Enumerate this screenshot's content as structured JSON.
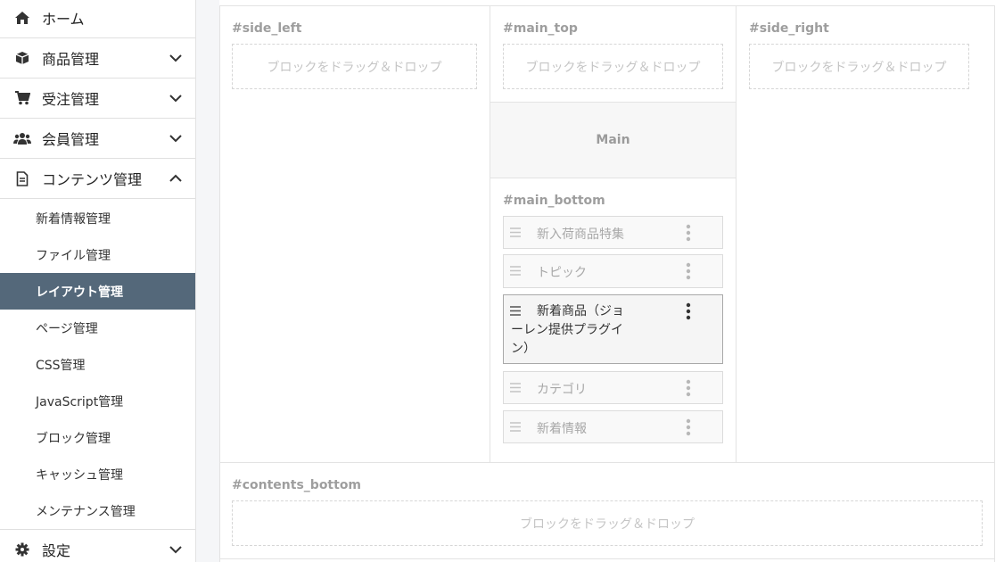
{
  "sidebar": {
    "home": "ホーム",
    "products": "商品管理",
    "orders": "受注管理",
    "members": "会員管理",
    "contents": "コンテンツ管理",
    "contents_sub": [
      "新着情報管理",
      "ファイル管理",
      "レイアウト管理",
      "ページ管理",
      "CSS管理",
      "JavaScript管理",
      "ブロック管理",
      "キャッシュ管理",
      "メンテナンス管理"
    ],
    "settings": "設定",
    "active_item": "レイアウト管理"
  },
  "layout": {
    "side_left": {
      "title": "#side_left",
      "placeholder": "ブロックをドラッグ＆ドロップ"
    },
    "main_top": {
      "title": "#main_top",
      "placeholder": "ブロックをドラッグ＆ドロップ"
    },
    "side_right": {
      "title": "#side_right",
      "placeholder": "ブロックをドラッグ＆ドロップ"
    },
    "main_label": "Main",
    "main_bottom": {
      "title": "#main_bottom",
      "blocks": [
        "新入荷商品特集",
        "トピック",
        "新着商品（ジョーレン提供プラグイン）",
        "カテゴリ",
        "新着情報"
      ]
    },
    "contents_bottom": {
      "title": "#contents_bottom",
      "placeholder": "ブロックをドラッグ＆ドロップ"
    }
  },
  "colors": {
    "active_bg": "#54687a",
    "muted_text": "#9e9e9e",
    "dropzone_border": "#d6d6d6"
  },
  "icons": [
    "home-icon",
    "box-icon",
    "cart-icon",
    "users-icon",
    "file-icon",
    "gear-icon",
    "chevron-down-icon",
    "chevron-up-icon",
    "drag-handle-icon",
    "kebab-menu-icon"
  ]
}
